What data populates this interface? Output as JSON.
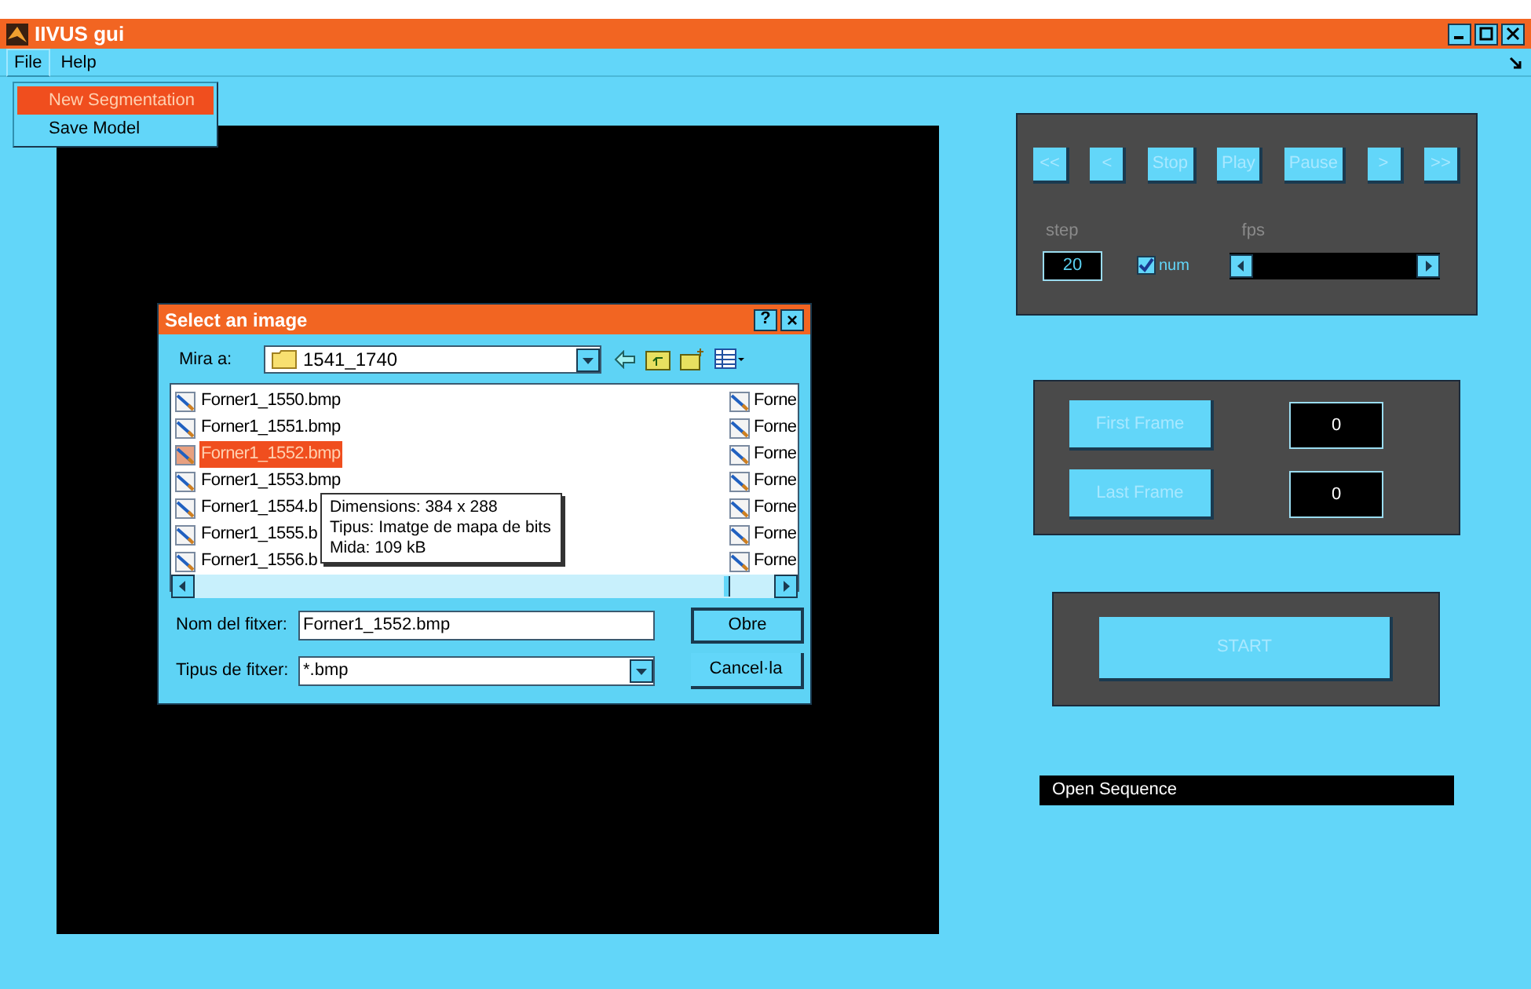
{
  "window": {
    "title": "IIVUS gui"
  },
  "menu": [
    {
      "label": "File",
      "selected": true
    },
    {
      "label": "Help",
      "selected": false
    }
  ],
  "file_menu": [
    {
      "label": "New Segmentation",
      "selected": true
    },
    {
      "label": "Save Model",
      "selected": false
    }
  ],
  "playback": {
    "buttons": [
      "<<",
      "<",
      "Stop",
      "Play",
      "Pause",
      ">",
      ">>"
    ],
    "step_label": "step",
    "step_value": "20",
    "num_checkbox": {
      "label": "num",
      "checked": true
    },
    "fps_label": "fps",
    "fps_slider": {
      "level": 0
    }
  },
  "frames": [
    {
      "button": "First Frame",
      "value": "0"
    },
    {
      "button": "Last Frame",
      "value": "0"
    }
  ],
  "start_button": "START",
  "status": "Open Sequence",
  "dialog": {
    "title": "Select an image",
    "help": "?",
    "close": "×",
    "look_in_label": "Mira a:",
    "look_in_value": "1541_1740",
    "files": [
      {
        "name": "Forner1_1550.bmp",
        "selected": false
      },
      {
        "name": "Forner1_1551.bmp",
        "selected": false
      },
      {
        "name": "Forner1_1552.bmp",
        "selected": true
      },
      {
        "name": "Forner1_1553.bmp",
        "selected": false
      },
      {
        "name": "Forner1_1554.b",
        "selected": false
      },
      {
        "name": "Forner1_1555.b",
        "selected": false
      },
      {
        "name": "Forner1_1556.b",
        "selected": false
      }
    ],
    "files_column_2": [
      "Forne",
      "Forne",
      "Forne",
      "Forne",
      "Forne",
      "Forne",
      "Forne"
    ],
    "tooltip": [
      "Dimensions: 384 x 288",
      "Tipus: Imatge de mapa de bits",
      "Mida: 109 kB"
    ],
    "filename_label": "Nom del fitxer:",
    "filename_value": "Forner1_1552.bmp",
    "open_button": "Obre",
    "filetype_label": "Tipus de fitxer:",
    "filetype_value": "*.bmp",
    "cancel_button": "Cancel·la"
  }
}
